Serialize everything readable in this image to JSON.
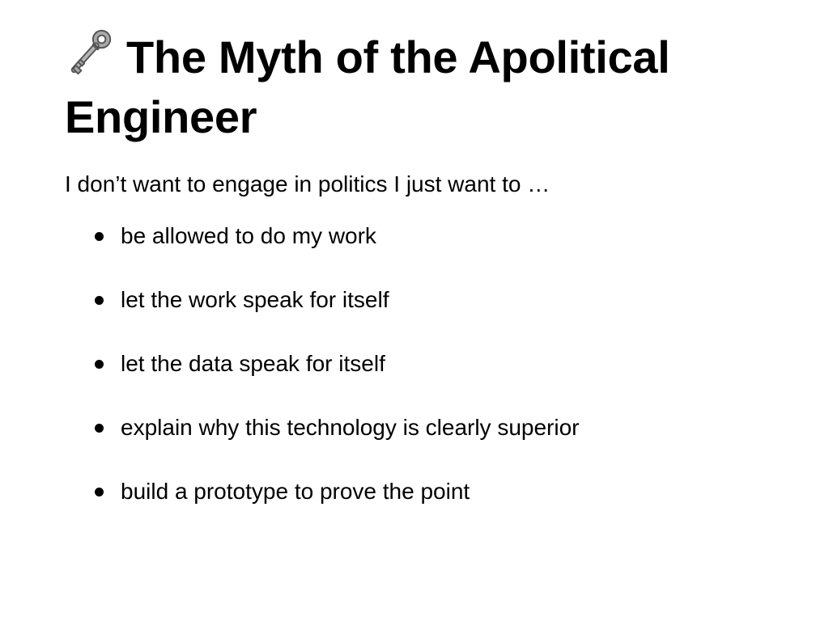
{
  "slide": {
    "icon": "old-key-icon",
    "title": "The Myth of the Apolitical Engineer",
    "intro": "I don’t want to engage in politics I just want to …",
    "bullets": [
      "be allowed to do my work",
      "let the work speak for itself",
      "let the data speak for itself",
      "explain why this technology is clearly superior",
      "build a prototype to prove the point"
    ]
  },
  "colors": {
    "background": "#ffffff",
    "text": "#000000",
    "key_metal": "#9a9a9a"
  }
}
